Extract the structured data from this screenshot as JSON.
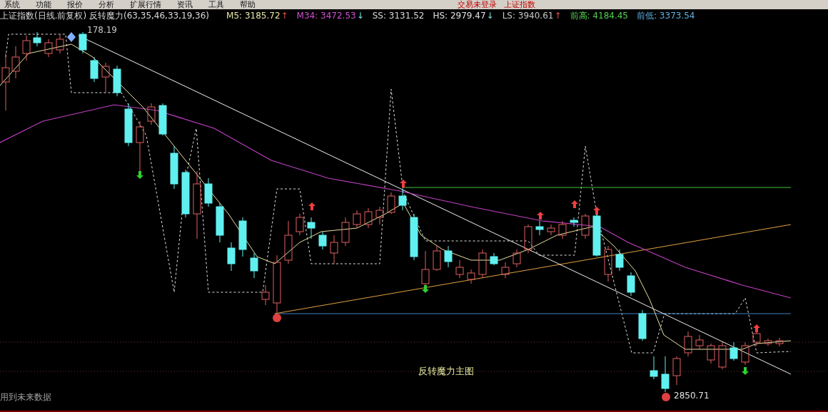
{
  "menu": [
    "系统",
    "功能",
    "报价",
    "分析",
    "扩展行情",
    "资讯",
    "工具",
    "帮助"
  ],
  "status": [
    "交易未登录",
    "上证指数"
  ],
  "title": "上证指数(日线.前复权) 反转魔力(63,35,46,33,19,36)",
  "indicators": [
    {
      "label": "M5: 3185.72",
      "arrow": "↑",
      "kind": "up",
      "color": "#e8e8a8"
    },
    {
      "label": "M34: 3472.53",
      "arrow": "↓",
      "kind": "down",
      "color": "#d050d0"
    },
    {
      "label": "SS: 3131.52",
      "color": "#d8d8d8"
    },
    {
      "label": "HS: 2979.47",
      "arrow": "↓",
      "kind": "down",
      "color": "#e0e0e0"
    },
    {
      "label": "LS: 3940.61",
      "arrow": "↑",
      "kind": "up",
      "color": "#c8c8c8"
    },
    {
      "label": "前高: 4184.45",
      "color": "#50d050"
    },
    {
      "label": "前低: 3373.54",
      "color": "#60b0e0"
    }
  ],
  "chart": {
    "high_label": "178.19",
    "low_label": "2850.71",
    "caption": "反转魔力主图",
    "footnote": "用到未来数据"
  }
}
